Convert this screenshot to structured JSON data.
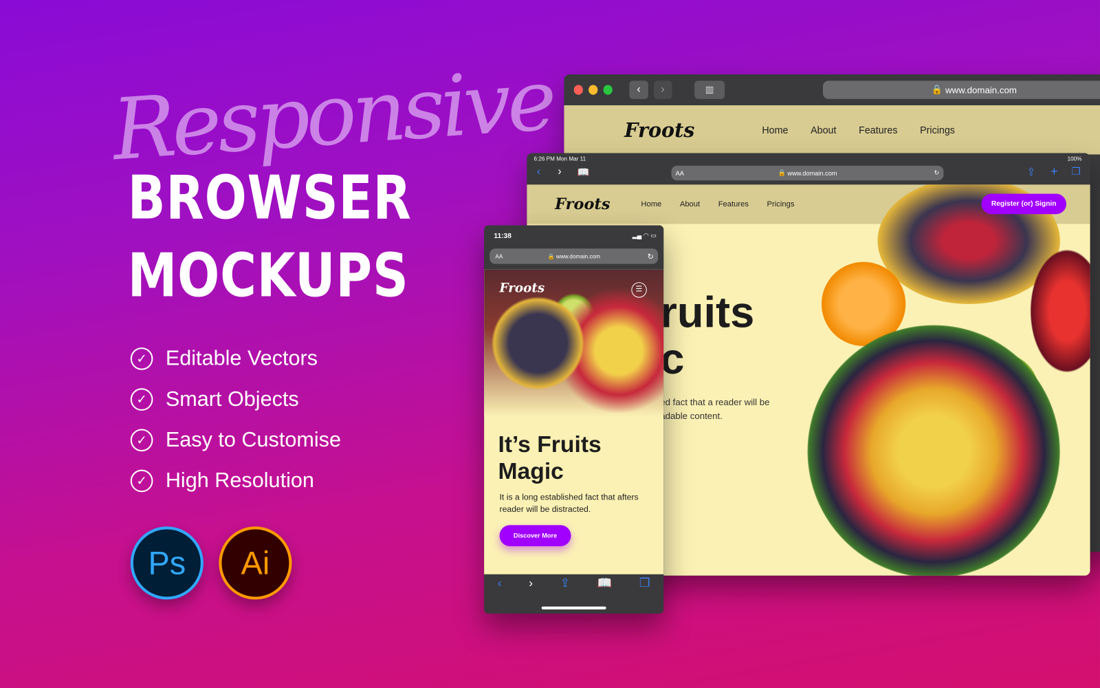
{
  "hero": {
    "script_word": "Responsive",
    "line1": "BROWSER",
    "line2": "MOCKUPS"
  },
  "features": [
    "Editable Vectors",
    "Smart Objects",
    "Easy to Customise",
    "High Resolution"
  ],
  "apps": [
    {
      "label": "Ps",
      "color": "#31a8ff"
    },
    {
      "label": "Ai",
      "color": "#ff9a00"
    }
  ],
  "desktop": {
    "url": "www.domain.com",
    "logo": "Froots",
    "nav": [
      "Home",
      "About",
      "Features",
      "Pricings"
    ]
  },
  "tablet": {
    "status_time": "6:26 PM  Mon Mar 11",
    "battery": "100%",
    "aa": "AA",
    "url": "www.domain.com",
    "logo": "Froots",
    "nav": [
      "Home",
      "About",
      "Features",
      "Pricings"
    ],
    "cta": "Register (or) Signin",
    "heading_1": "ruits",
    "heading_2": "c",
    "body_1": "ed fact that a reader will be",
    "body_2": "adable content."
  },
  "phone": {
    "time": "11:38",
    "aa": "AA",
    "url": "www.domain.com",
    "logo": "Froots",
    "heading": "It’s Fruits Magic",
    "body": "It is a long established fact that afters reader will be distracted.",
    "cta": "Discover More"
  },
  "colors": {
    "accent": "#a100ff",
    "page_bg": "#fbf1b4",
    "nav_bg": "#d8cc92"
  }
}
